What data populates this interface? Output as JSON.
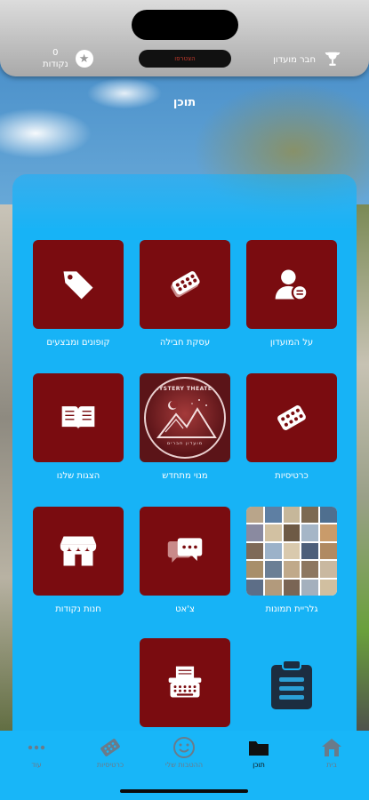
{
  "header": {
    "points_value": "0",
    "points_label": "נקודות",
    "club_label": "חבר מועדון",
    "pill_text": "הצטרפו"
  },
  "page": {
    "title": "תוכן"
  },
  "tiles": [
    {
      "label": "על המועדון",
      "icon": "user-info-icon"
    },
    {
      "label": "עסקת חבילה",
      "icon": "tickets-icon"
    },
    {
      "label": "קופונים ומבצעים",
      "icon": "tag-icon"
    },
    {
      "label": "כרטיסיות",
      "icon": "ticket-card-icon"
    },
    {
      "label": "מנוי מתחדש",
      "icon": "club-logo"
    },
    {
      "label": "הצגות שלנו",
      "icon": "book-icon"
    },
    {
      "label": "גלריית תמונות",
      "icon": "photo-gallery"
    },
    {
      "label": "צ'אט",
      "icon": "chat-icon"
    },
    {
      "label": "חנות נקודות",
      "icon": "store-icon"
    },
    {
      "label": "",
      "icon": "typewriter-icon"
    }
  ],
  "logo": {
    "top_text": "MYSTERY THEATER",
    "bottom_text": "מועדון חברים"
  },
  "tabbar": {
    "tabs": [
      {
        "label": "בית",
        "icon": "home-icon",
        "active": false
      },
      {
        "label": "תוכן",
        "icon": "folder-icon",
        "active": true
      },
      {
        "label": "ההטבות שלי",
        "icon": "smile-icon",
        "active": false
      },
      {
        "label": "כרטיסיות",
        "icon": "ticket-icon",
        "active": false
      },
      {
        "label": "עוד",
        "icon": "more-icon",
        "active": false
      }
    ]
  },
  "colors": {
    "tile_bg": "#7a0c10",
    "panel_bg": "#17b3f6",
    "tabbar_bg": "#18b6f8"
  }
}
